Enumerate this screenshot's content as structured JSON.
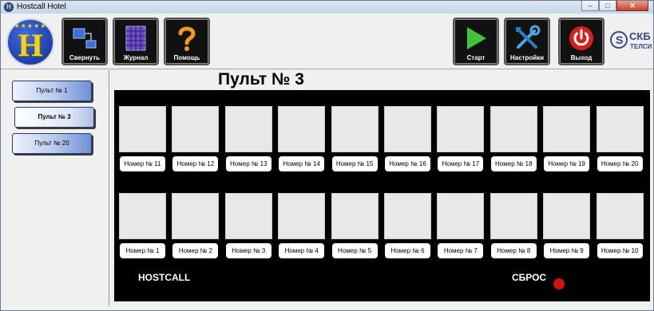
{
  "window": {
    "title": "Hostcall Hotel",
    "app_icon_letter": "H",
    "controls": [
      "–",
      "□",
      "✕"
    ]
  },
  "toolbar": {
    "logo_letter": "H",
    "buttons_left": [
      {
        "label": "Свернуть",
        "icon": "flow-diagram-icon"
      },
      {
        "label": "Журнал",
        "icon": "log-grid-icon"
      },
      {
        "label": "Помощь",
        "icon": "question-mark-icon"
      }
    ],
    "buttons_right": [
      {
        "label": "Старт",
        "icon": "play-icon"
      },
      {
        "label": "Настройки",
        "icon": "tools-icon"
      },
      {
        "label": "Выход",
        "icon": "power-icon"
      }
    ],
    "brand": {
      "line1": "СКБ",
      "line2": "ТЕЛСИ"
    }
  },
  "sidebar": {
    "items": [
      {
        "label": "Пульт № 1",
        "active": false
      },
      {
        "label": "Пульт № 3",
        "active": true
      },
      {
        "label": "Пульт № 20",
        "active": false
      }
    ]
  },
  "panel": {
    "title": "Пульт № 3",
    "rows": [
      [
        "Номер № 11",
        "Номер № 12",
        "Номер № 13",
        "Номер № 14",
        "Номер № 15",
        "Номер № 16",
        "Номер № 17",
        "Номер № 18",
        "Номер № 19",
        "Номер № 20"
      ],
      [
        "Номер № 1",
        "Номер № 2",
        "Номер № 3",
        "Номер № 4",
        "Номер № 5",
        "Номер № 6",
        "Номер № 7",
        "Номер № 8",
        "Номер № 9",
        "Номер № 10"
      ]
    ],
    "hostcall_label": "HOSTCALL",
    "reset_label": "СБРОС",
    "reset_indicator_color": "#d01414",
    "board_color": "#000000"
  }
}
